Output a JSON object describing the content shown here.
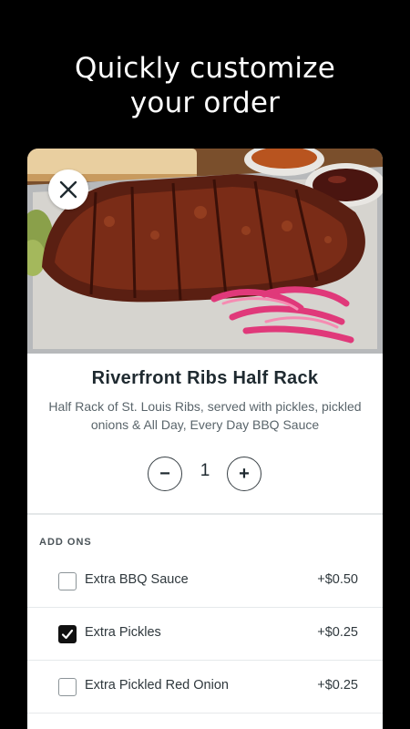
{
  "hero": {
    "line1": "Quickly customize",
    "line2": "your order"
  },
  "item": {
    "name": "Riverfront Ribs Half Rack",
    "description": "Half Rack of St. Louis Ribs, served with pickles, pickled onions & All Day, Every Day BBQ Sauce",
    "quantity": "1",
    "minus_label": "−",
    "plus_label": "+",
    "image_icon": "ribs-photo"
  },
  "addons": {
    "header": "ADD ONS",
    "items": [
      {
        "label": "Extra BBQ Sauce",
        "price": "+$0.50",
        "checked": false
      },
      {
        "label": "Extra Pickles",
        "price": "+$0.25",
        "checked": true
      },
      {
        "label": "Extra Pickled Red Onion",
        "price": "+$0.25",
        "checked": false
      }
    ]
  },
  "colors": {
    "background": "#000000",
    "card": "#ffffff",
    "text_dark": "#1f2a30",
    "checkbox_checked": "#111111"
  }
}
